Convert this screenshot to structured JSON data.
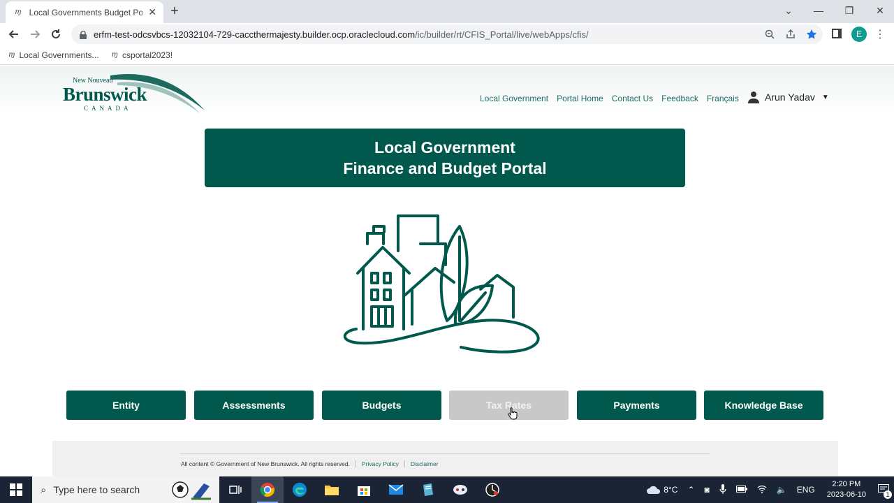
{
  "browser": {
    "tab_title": "Local Governments Budget Porta",
    "url_host": "erfm-test-odcsvbcs-12032104-729-caccthermajesty.builder.ocp.oraclecloud.com",
    "url_path": "/ic/builder/rt/CFIS_Portal/live/webApps/cfis/",
    "profile_initial": "E",
    "bookmarks": [
      "Local Governments...",
      "csportal2023!"
    ]
  },
  "header": {
    "logo_top": "New Nouveau",
    "logo_main": "Brunswick",
    "logo_sub": "CANADA",
    "nav": [
      "Local Government",
      "Portal Home",
      "Contact Us",
      "Feedback",
      "Français"
    ],
    "user_name": "Arun Yadav"
  },
  "banner": {
    "line1": "Local Government",
    "line2": "Finance and Budget Portal"
  },
  "tiles": [
    {
      "label": "Entity",
      "disabled": false
    },
    {
      "label": "Assessments",
      "disabled": false
    },
    {
      "label": "Budgets",
      "disabled": false
    },
    {
      "label": "Tax Rates",
      "disabled": true
    },
    {
      "label": "Payments",
      "disabled": false
    },
    {
      "label": "Knowledge Base",
      "disabled": false
    }
  ],
  "footer": {
    "copyright": "All content © Government of New Brunswick. All rights reserved.",
    "privacy": "Privacy Policy",
    "disclaimer": "Disclaimer"
  },
  "taskbar": {
    "search_placeholder": "Type here to search",
    "weather": "8°C",
    "language": "ENG",
    "time": "2:20 PM",
    "date": "2023-06-10",
    "notification_count": "1"
  },
  "colors": {
    "brand_green": "#00594c",
    "link_green": "#1a6e63",
    "disabled_tile": "#c8c8c8"
  }
}
